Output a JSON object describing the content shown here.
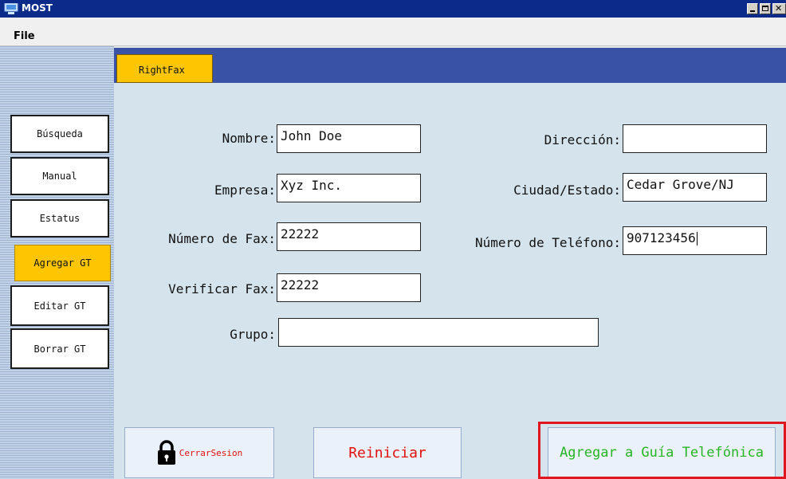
{
  "window": {
    "title": "MOST"
  },
  "menu": {
    "file_label": "File"
  },
  "tabs": [
    {
      "label": "RightFax"
    }
  ],
  "sidebar": {
    "items": [
      {
        "label": "Búsqueda"
      },
      {
        "label": "Manual"
      },
      {
        "label": "Estatus"
      },
      {
        "label": "Agregar GT",
        "active": true
      },
      {
        "label": "Editar GT"
      },
      {
        "label": "Borrar GT"
      }
    ]
  },
  "form": {
    "nombre": {
      "label": "Nombre:",
      "value": "John Doe"
    },
    "empresa": {
      "label": "Empresa:",
      "value": "Xyz Inc."
    },
    "numero_fax": {
      "label": "Número de Fax:",
      "value": "22222"
    },
    "verificar_fax": {
      "label": "Verificar Fax:",
      "value": "22222"
    },
    "grupo": {
      "label": "Grupo:",
      "value": ""
    },
    "direccion": {
      "label": "Dirección:",
      "value": ""
    },
    "ciudad_estado": {
      "label": "Ciudad/Estado:",
      "value": "Cedar Grove/NJ"
    },
    "numero_telefono": {
      "label": "Número de Teléfono:",
      "value": "907123456"
    }
  },
  "buttons": {
    "cerrar_sesion": "CerrarSesion",
    "reiniciar": "Reiniciar",
    "agregar": "Agregar a Guía Telefónica"
  },
  "colors": {
    "titlebar": "#0c2a8a",
    "tab_strip": "#3a52a6",
    "active_yellow": "#fec502",
    "content_bg": "#d5e3ed",
    "highlight_red": "#e0161e",
    "agregar_text": "#26b526"
  },
  "icons": {
    "app": "computer-icon",
    "logout": "padlock-icon"
  }
}
